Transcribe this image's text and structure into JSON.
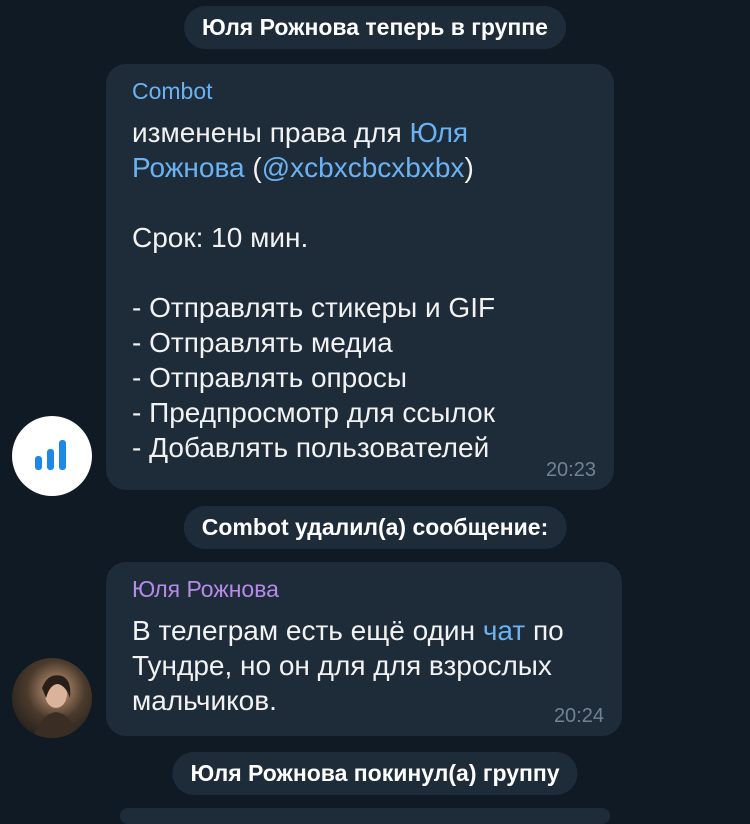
{
  "service_joined": "Юля Рожнова теперь в группе",
  "bot_message": {
    "sender": "Combot",
    "line1_prefix": "изменены права для ",
    "line1_name": "Юля\nРожнова",
    "line1_open": " (",
    "line1_username": "@xcbxcbcxbxbx",
    "line1_close": ")",
    "term": "Срок: 10 мин.",
    "permissions": "- Отправлять стикеры и GIF\n- Отправлять медиа\n- Отправлять опросы\n- Предпросмотр для ссылок\n- Добавлять пользователей",
    "time": "20:23"
  },
  "service_deleted": "Combot удалил(а) сообщение:",
  "user_message": {
    "sender": "Юля Рожнова",
    "text_before": "В телеграм есть ещё один ",
    "text_link": "чат",
    "text_after": " по\nТундре, но он для для взрослых\nмальчиков.",
    "time": "20:24"
  },
  "service_left": "Юля Рожнова покинул(а) группу",
  "colors": {
    "background": "#0f1a24",
    "bubble": "#1e2c3a",
    "link": "#6ab2f2",
    "bot_sender": "#6ab2f2",
    "user_sender": "#b68be8",
    "time": "#6f8394"
  },
  "icons": {
    "bot_avatar": "bar-chart-icon",
    "user_avatar": "user-photo"
  }
}
